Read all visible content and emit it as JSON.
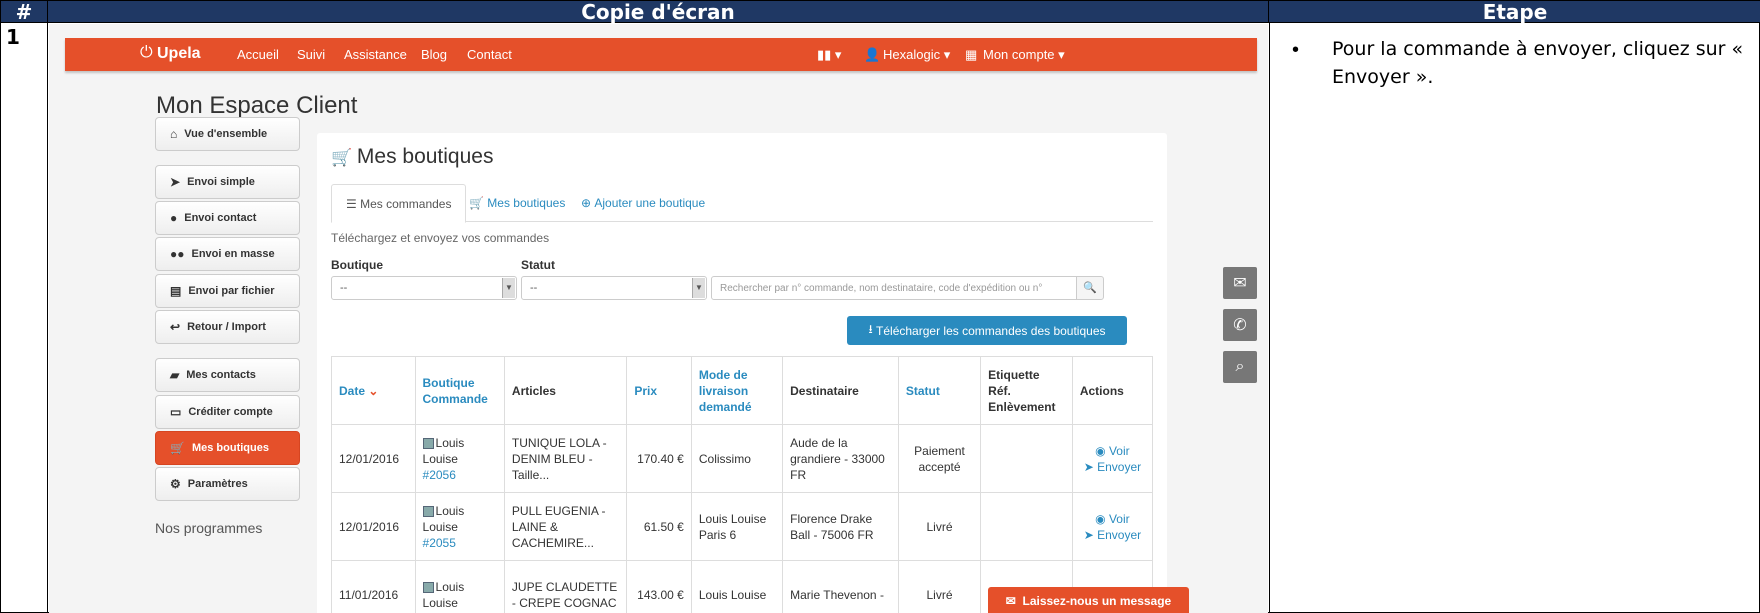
{
  "doc": {
    "col_num": "#",
    "col_shot": "Copie d'écran",
    "col_step": "Etape",
    "row_number": "1",
    "step_text": "Pour la commande à envoyer, cliquez sur « Envoyer »."
  },
  "topbar": {
    "brand": "Upela",
    "nav": [
      "Accueil",
      "Suivi",
      "Assistance",
      "Blog",
      "Contact"
    ],
    "user": "Hexalogic",
    "account": "Mon compte"
  },
  "page_title": "Mon Espace Client",
  "sidebar": {
    "items": [
      {
        "label": "Vue d'ensemble",
        "icon": "home-icon"
      },
      {
        "label": "Envoi simple",
        "icon": "paper-plane-icon"
      },
      {
        "label": "Envoi contact",
        "icon": "user-icon"
      },
      {
        "label": "Envoi en masse",
        "icon": "users-icon"
      },
      {
        "label": "Envoi par fichier",
        "icon": "file-icon"
      },
      {
        "label": "Retour / Import",
        "icon": "reply-icon"
      },
      {
        "label": "Mes contacts",
        "icon": "book-icon"
      },
      {
        "label": "Créditer compte",
        "icon": "credit-card-icon"
      },
      {
        "label": "Mes boutiques",
        "icon": "cart-icon"
      },
      {
        "label": "Paramètres",
        "icon": "gears-icon"
      }
    ],
    "programs_label": "Nos programmes"
  },
  "panel": {
    "title": "Mes boutiques",
    "tabs": [
      "Mes commandes",
      "Mes boutiques",
      "Ajouter une boutique"
    ],
    "subtitle": "Téléchargez et envoyez vos commandes",
    "boutique_label": "Boutique",
    "statut_label": "Statut",
    "select_value": "--",
    "search_placeholder": "Rechercher par n° commande, nom destinataire, code d'expédition ou n°",
    "download_button": "Télécharger les commandes des boutiques"
  },
  "table": {
    "headers": {
      "date": "Date",
      "boutique_l1": "Boutique",
      "boutique_l2": "Commande",
      "articles": "Articles",
      "prix": "Prix",
      "mode_l1": "Mode de",
      "mode_l2": "livraison",
      "mode_l3": "demandé",
      "destinataire": "Destinataire",
      "statut": "Statut",
      "etiq_l1": "Etiquette",
      "etiq_l2": "Réf.",
      "etiq_l3": "Enlèvement",
      "actions": "Actions"
    },
    "rows": [
      {
        "date": "12/01/2016",
        "shop_l1": "Louis",
        "shop_l2": "Louise",
        "order": "#2056",
        "article_l1": "TUNIQUE LOLA -",
        "article_l2": "DENIM BLEU -",
        "article_l3": "Taille...",
        "price": "170.40 €",
        "mode_l1": "Colissimo",
        "mode_l2": "",
        "dest_l1": "Aude de la",
        "dest_l2": "grandiere - 33000",
        "dest_l3": "FR",
        "status_l1": "Paiement",
        "status_l2": "accepté",
        "view": "Voir",
        "send": "Envoyer"
      },
      {
        "date": "12/01/2016",
        "shop_l1": "Louis",
        "shop_l2": "Louise",
        "order": "#2055",
        "article_l1": "PULL EUGENIA -",
        "article_l2": "LAINE &",
        "article_l3": "CACHEMIRE...",
        "price": "61.50 €",
        "mode_l1": "Louis Louise",
        "mode_l2": "Paris 6",
        "dest_l1": "Florence Drake",
        "dest_l2": "Ball - 75006 FR",
        "dest_l3": "",
        "status_l1": "Livré",
        "status_l2": "",
        "view": "Voir",
        "send": "Envoyer"
      },
      {
        "date": "11/01/2016",
        "shop_l1": "Louis",
        "shop_l2": "Louise",
        "order": "",
        "article_l1": "JUPE CLAUDETTE",
        "article_l2": "- CREPE COGNAC",
        "article_l3": "",
        "price": "143.00 €",
        "mode_l1": "Louis Louise",
        "mode_l2": "",
        "dest_l1": "Marie Thevenon -",
        "dest_l2": "",
        "dest_l3": "",
        "status_l1": "Livré",
        "status_l2": "",
        "view": "",
        "send": ""
      }
    ]
  },
  "message_button": "Laissez-nous un message"
}
